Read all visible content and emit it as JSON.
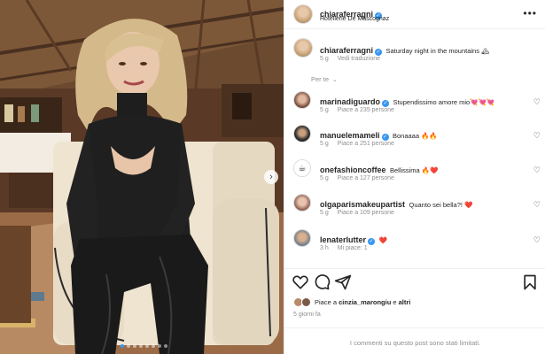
{
  "post": {
    "username": "chiaraferragni",
    "location": "Hotellerie De Mascognaz",
    "caption_text": "Saturday night in the mountains 🏔",
    "caption_time": "5 g",
    "translate": "Vedi traduzione",
    "filter_label": "Per te",
    "date": "5 giorni fa",
    "limited_notice": "I commenti su questo post sono stati limitati."
  },
  "comments": [
    {
      "user": "marinadiguardo",
      "verified": true,
      "text": "Stupendissimo amore mio💘💘💘",
      "time": "5 g",
      "likes": "Piace a 235 persone"
    },
    {
      "user": "manuelemameli",
      "verified": true,
      "text": "Bonaaaa 🔥🔥",
      "time": "5 g",
      "likes": "Piace a 251 persone"
    },
    {
      "user": "onefashioncoffee",
      "verified": false,
      "text": "Bellissima 🔥❤️",
      "time": "5 g",
      "likes": "Piace a 127 persone"
    },
    {
      "user": "olgaparismakeupartist",
      "verified": false,
      "text": "Quanto sei bella?! ❤️",
      "time": "5 g",
      "likes": "Piace a 109 persone"
    },
    {
      "user": "lenaterlutter",
      "verified": true,
      "text": "❤️",
      "time": "3 h",
      "likes": "Mi piace: 1"
    }
  ],
  "liked_by": {
    "prefix": "Piace a ",
    "user": "cinzia_marongiu",
    "suffix": " e ",
    "others": "altri"
  },
  "icons": {
    "more": "more-horizontal-icon",
    "like": "heart-icon",
    "comment": "comment-icon",
    "share": "paper-plane-icon",
    "save": "bookmark-icon",
    "verified": "verified-badge-icon",
    "next": "chevron-right-icon",
    "filter": "chevron-down-icon"
  },
  "carousel": {
    "count": 8,
    "active": 0
  },
  "colors": {
    "verified": "#3897f0",
    "text": "#262626",
    "muted": "#8e8e8e",
    "like_red": "#ed4956"
  }
}
